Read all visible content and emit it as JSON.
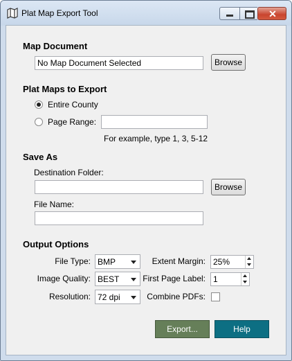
{
  "window": {
    "title": "Plat Map Export Tool",
    "close_glyph": "✕",
    "icons": {
      "app": "map-icon",
      "minimize": "minimize-icon",
      "maximize": "maximize-icon",
      "close": "close-icon"
    }
  },
  "map_document": {
    "heading": "Map Document",
    "value": "No Map Document Selected",
    "browse_label": "Browse"
  },
  "plat_maps": {
    "heading": "Plat Maps to Export",
    "option_entire": "Entire County",
    "option_range": "Page Range:",
    "selected": "Entire County",
    "range_value": "",
    "hint": "For example, type 1, 3, 5-12"
  },
  "save_as": {
    "heading": "Save As",
    "destination_label": "Destination Folder:",
    "destination_value": "",
    "browse_label": "Browse",
    "file_name_label": "File Name:",
    "file_name_value": ""
  },
  "output_options": {
    "heading": "Output Options",
    "file_type_label": "File Type:",
    "file_type_value": "BMP",
    "image_quality_label": "Image Quality:",
    "image_quality_value": "BEST",
    "resolution_label": "Resolution:",
    "resolution_value": "72 dpi",
    "extent_margin_label": "Extent Margin:",
    "extent_margin_value": "25%",
    "first_page_label": "First Page Label:",
    "first_page_value": "1",
    "combine_pdfs_label": "Combine PDFs:",
    "combine_pdfs_checked": false
  },
  "buttons": {
    "export_label": "Export...",
    "help_label": "Help",
    "export_color": "#667f59",
    "help_color": "#0d6f83"
  }
}
